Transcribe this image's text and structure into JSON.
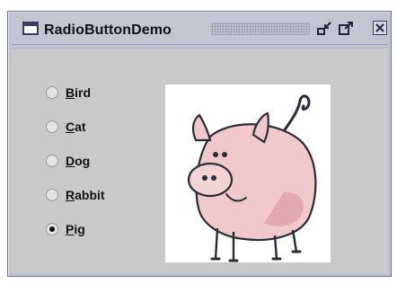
{
  "window": {
    "title": "RadioButtonDemo"
  },
  "titlebar_icons": {
    "app": "window-icon",
    "minimize": "minimize-icon",
    "maximize": "maximize-icon",
    "close": "close-icon"
  },
  "radio_group": {
    "options": [
      {
        "label": "Bird",
        "selected": false
      },
      {
        "label": "Cat",
        "selected": false
      },
      {
        "label": "Dog",
        "selected": false
      },
      {
        "label": "Rabbit",
        "selected": false
      },
      {
        "label": "Pig",
        "selected": true
      }
    ]
  },
  "picture": {
    "subject": "pig-image"
  },
  "colors": {
    "window_bg": "#c9c9c9",
    "pig_pink": "#f1c8cc",
    "outline": "#2b2b35"
  }
}
